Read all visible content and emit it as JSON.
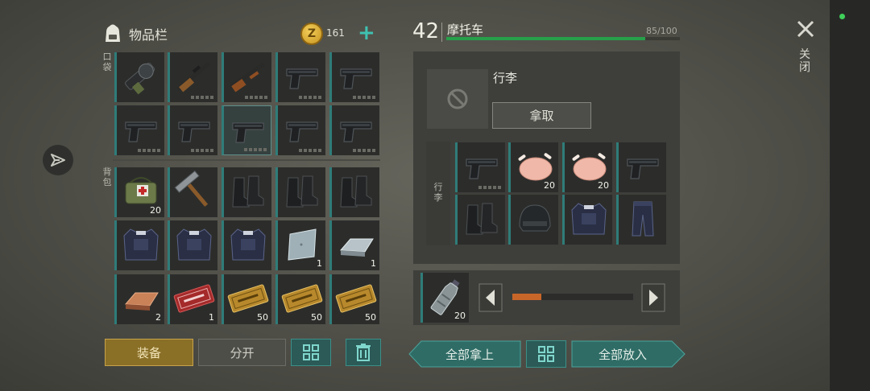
{
  "inventory": {
    "title": "物品栏",
    "coin_symbol": "Z",
    "coins": "161",
    "add_symbol": "+",
    "pockets_label": "口袋",
    "backpack_label": "背包",
    "pocket_slots": [
      {
        "icon": "grenade-launcher-icon",
        "qty": "",
        "durability": false
      },
      {
        "icon": "rifle-icon",
        "qty": "",
        "durability": true
      },
      {
        "icon": "shotgun-icon",
        "qty": "",
        "durability": true
      },
      {
        "icon": "pistol-icon",
        "qty": "",
        "durability": true
      },
      {
        "icon": "pistol-icon",
        "qty": "",
        "durability": true
      },
      {
        "icon": "pistol-icon",
        "qty": "",
        "durability": true
      },
      {
        "icon": "pistol-icon",
        "qty": "",
        "durability": true
      },
      {
        "icon": "pistol-icon",
        "qty": "",
        "durability": true,
        "selected": true
      },
      {
        "icon": "pistol-icon",
        "qty": "",
        "durability": true
      },
      {
        "icon": "pistol-icon",
        "qty": "",
        "durability": true
      }
    ],
    "backpack_slots": [
      {
        "icon": "medkit-bag-icon",
        "qty": "20"
      },
      {
        "icon": "hammer-icon",
        "qty": ""
      },
      {
        "icon": "boots-icon",
        "qty": ""
      },
      {
        "icon": "boots-icon",
        "qty": ""
      },
      {
        "icon": "boots-icon",
        "qty": ""
      },
      {
        "icon": "armor-vest-icon",
        "qty": ""
      },
      {
        "icon": "armor-vest-icon",
        "qty": ""
      },
      {
        "icon": "armor-vest-icon",
        "qty": ""
      },
      {
        "icon": "steel-plate-icon",
        "qty": "1"
      },
      {
        "icon": "metal-ingot-icon",
        "qty": "1"
      },
      {
        "icon": "copper-ingot-icon",
        "qty": "2"
      },
      {
        "icon": "red-coupon-icon",
        "qty": "1"
      },
      {
        "icon": "gold-coupon-icon",
        "qty": "50"
      },
      {
        "icon": "gold-coupon-icon",
        "qty": "50"
      },
      {
        "icon": "gold-coupon-icon",
        "qty": "50"
      }
    ],
    "equip_label": "装备",
    "split_label": "分开"
  },
  "vehicle": {
    "level": "42",
    "name": "摩托车",
    "capacity": "85/100",
    "fill_fraction": 0.85,
    "bag_title": "行李",
    "take_label": "拿取",
    "pouch_label": "行李",
    "slots": [
      {
        "icon": "pistol-icon",
        "qty": "",
        "durability": true
      },
      {
        "icon": "roast-chicken-icon",
        "qty": "20"
      },
      {
        "icon": "roast-chicken-icon",
        "qty": "20"
      },
      {
        "icon": "pistol-icon",
        "qty": ""
      },
      {
        "icon": "boots-icon",
        "qty": ""
      },
      {
        "icon": "helmet-icon",
        "qty": ""
      },
      {
        "icon": "armor-vest-icon",
        "qty": ""
      },
      {
        "icon": "pants-icon",
        "qty": ""
      }
    ],
    "fuel_qty": "20",
    "fuel_icon": "water-bottle-icon",
    "fuel_fraction": 0.24
  },
  "actions": {
    "take_all_label": "全部拿上",
    "put_all_label": "全部放入"
  },
  "window": {
    "close_label": "关闭"
  },
  "colors": {
    "accent": "#2f7c79",
    "capacity_bar": "#27a04a",
    "equip_button": "#8a6f27",
    "slider_fill": "#c8662a"
  }
}
